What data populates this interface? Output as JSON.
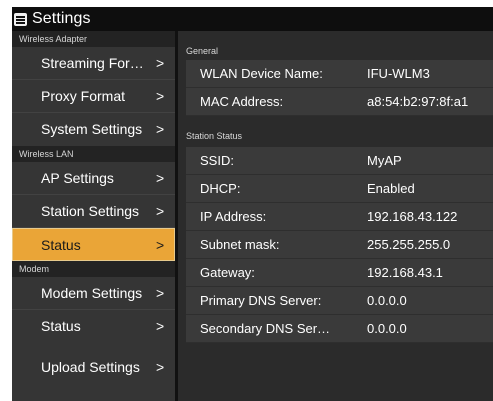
{
  "window": {
    "title": "Settings"
  },
  "sidebar": {
    "sections": [
      {
        "header": "Wireless Adapter",
        "items": [
          {
            "label": "Streaming For…"
          },
          {
            "label": "Proxy Format"
          },
          {
            "label": "System Settings"
          }
        ]
      },
      {
        "header": "Wireless LAN",
        "items": [
          {
            "label": "AP Settings"
          },
          {
            "label": "Station Settings"
          },
          {
            "label": "Status"
          }
        ]
      },
      {
        "header": "Modem",
        "items": [
          {
            "label": "Modem Settings"
          },
          {
            "label": "Status"
          }
        ]
      }
    ],
    "footer_item": {
      "label": "Upload Settings"
    },
    "active_item": "Wireless LAN / Status",
    "chevron": ">"
  },
  "content": {
    "general": {
      "header": "General",
      "rows": [
        {
          "label": "WLAN Device Name:",
          "value": "IFU-WLM3"
        },
        {
          "label": "MAC Address:",
          "value": "a8:54:b2:97:8f:a1"
        }
      ]
    },
    "station_status": {
      "header": "Station Status",
      "rows": [
        {
          "label": "SSID:",
          "value": "MyAP"
        },
        {
          "label": "DHCP:",
          "value": "Enabled"
        },
        {
          "label": "IP Address:",
          "value": "192.168.43.122"
        },
        {
          "label": "Subnet mask:",
          "value": "255.255.255.0"
        },
        {
          "label": "Gateway:",
          "value": "192.168.43.1"
        },
        {
          "label": "Primary DNS Server:",
          "value": "0.0.0.0"
        },
        {
          "label": "Secondary DNS Ser…",
          "value": "0.0.0.0"
        }
      ]
    }
  },
  "colors": {
    "accent": "#eaa537",
    "titlebar": "#0e0e0e",
    "sidebar_bg": "#353535",
    "content_bg": "#2b2b2b",
    "row_bg": "#3a3a3a"
  },
  "icons": {
    "menu": "hamburger-menu-icon",
    "chevron": "chevron-right-icon"
  }
}
